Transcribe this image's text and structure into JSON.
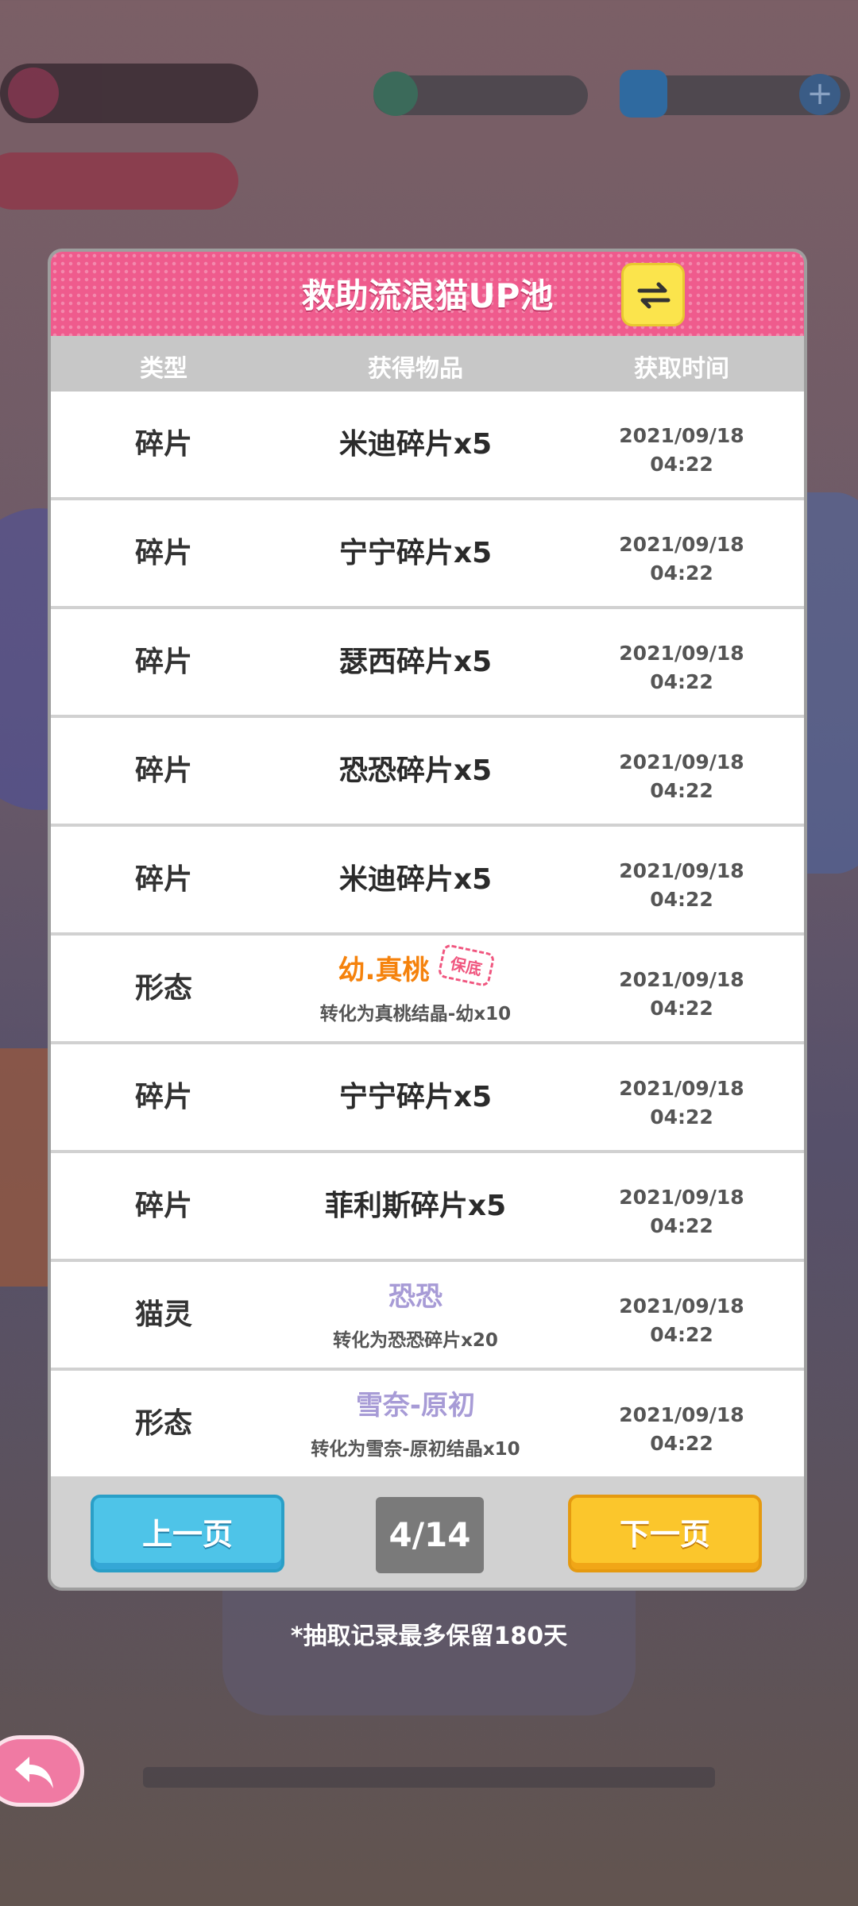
{
  "dialog": {
    "title": "救助流浪猫UP池",
    "switch_icon": "swap-arrows-icon"
  },
  "columns": {
    "type": "类型",
    "item": "获得物品",
    "time": "获取时间"
  },
  "rows": [
    {
      "type": "碎片",
      "item": "米迪碎片x5",
      "date": "2021/09/18",
      "time": "04:22"
    },
    {
      "type": "碎片",
      "item": "宁宁碎片x5",
      "date": "2021/09/18",
      "time": "04:22"
    },
    {
      "type": "碎片",
      "item": "瑟西碎片x5",
      "date": "2021/09/18",
      "time": "04:22"
    },
    {
      "type": "碎片",
      "item": "恐恐碎片x5",
      "date": "2021/09/18",
      "time": "04:22"
    },
    {
      "type": "碎片",
      "item": "米迪碎片x5",
      "date": "2021/09/18",
      "time": "04:22"
    },
    {
      "type": "形态",
      "item": "幼.真桃",
      "badge": "保底",
      "sub": "转化为真桃结晶-幼x10",
      "date": "2021/09/18",
      "time": "04:22"
    },
    {
      "type": "碎片",
      "item": "宁宁碎片x5",
      "date": "2021/09/18",
      "time": "04:22"
    },
    {
      "type": "碎片",
      "item": "菲利斯碎片x5",
      "date": "2021/09/18",
      "time": "04:22"
    },
    {
      "type": "猫灵",
      "item": "恐恐",
      "sub": "转化为恐恐碎片x20",
      "date": "2021/09/18",
      "time": "04:22"
    },
    {
      "type": "形态",
      "item": "雪奈-原初",
      "sub": "转化为雪奈-原初结晶x10",
      "date": "2021/09/18",
      "time": "04:22"
    }
  ],
  "pagination": {
    "prev": "上一页",
    "next": "下一页",
    "indicator": "4/14"
  },
  "footer_note": "*抽取记录最多保留180天",
  "colors": {
    "header": "#ef5b8d",
    "prev": "#4ec4e8",
    "next": "#fbc62c",
    "rare": "#f5820c",
    "epic": "#a79bd6"
  }
}
